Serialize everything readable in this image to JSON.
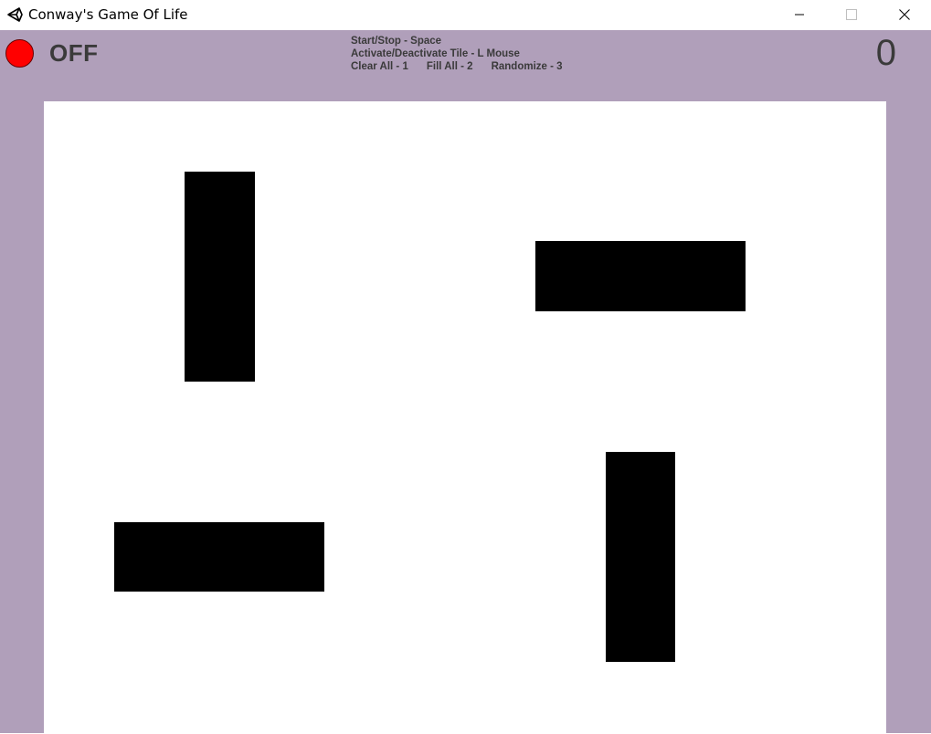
{
  "window": {
    "title": "Conway's Game Of Life",
    "icon": "unity-icon",
    "controls": [
      "minimize-icon",
      "maximize-icon",
      "close-icon"
    ]
  },
  "hud": {
    "status": "OFF",
    "status_color": "#ff0000",
    "generation": "0",
    "help": {
      "line1": "Start/Stop - Space",
      "line2": "Activate/Deactivate Tile - L Mouse",
      "clear": "Clear All - 1",
      "fill": "Fill All - 2",
      "randomize": "Randomize - 3"
    }
  },
  "colors": {
    "background": "#b09fba",
    "board": "#ffffff",
    "live_cell": "#000000"
  }
}
